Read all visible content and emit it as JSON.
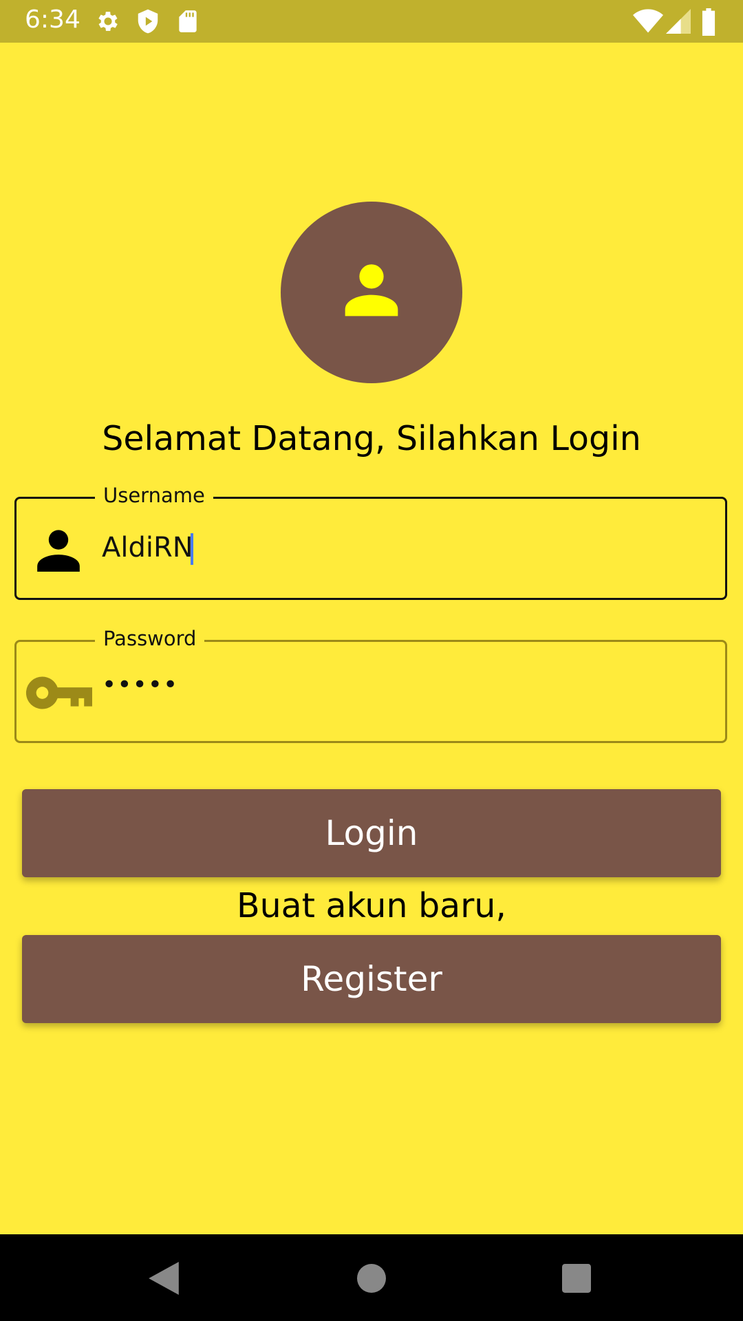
{
  "status_bar": {
    "time": "6:34",
    "icons": [
      "gear-icon",
      "shield-play-icon",
      "sd-card-icon",
      "wifi-icon",
      "signal-icon",
      "battery-icon"
    ]
  },
  "login": {
    "welcome_text": "Selamat Datang, Silahkan Login",
    "avatar_icon": "person-icon",
    "username": {
      "label": "Username",
      "value": "AldiRN",
      "icon": "person-icon"
    },
    "password": {
      "label": "Password",
      "masked_value": "•••••",
      "icon": "key-icon"
    },
    "login_button": "Login",
    "register_hint": "Buat akun baru,",
    "register_button": "Register"
  },
  "nav_bar": {
    "icons": [
      "back-icon",
      "home-icon",
      "recents-icon"
    ]
  },
  "colors": {
    "background": "#FFEB3B",
    "status_bar": "#C0B12D",
    "primary_brown": "#795548",
    "avatar_icon": "#FFFF00",
    "password_accent": "#9C8A18",
    "cursor": "#4A7CF0"
  }
}
